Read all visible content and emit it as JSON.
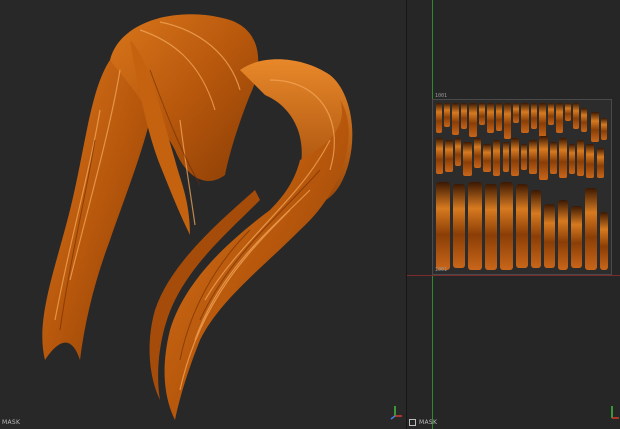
{
  "viewport_3d": {
    "mask_label": "MASK"
  },
  "viewport_uv": {
    "mask_label": "MASK",
    "uv_label_top": "1001",
    "uv_label_bottom": "1001"
  },
  "colors": {
    "background": "#282828",
    "hair_dark": "#7a3406",
    "hair_mid": "#c2620f",
    "hair_light": "#f0a14a",
    "axis_x": "#d23a2a",
    "axis_y": "#3fbf3f",
    "axis_z": "#3f7fe0"
  },
  "icons": {
    "gizmo_3d": "axis-gizmo-icon",
    "gizmo_uv": "uv-axis-icon",
    "mask_toggle": "checkbox-icon"
  }
}
